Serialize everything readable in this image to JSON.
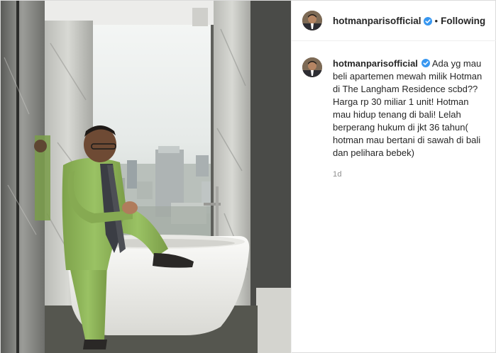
{
  "post": {
    "username": "hotmanparisofficial",
    "separator": "•",
    "follow_status": "Following",
    "caption_lines": [
      "Ada yg mau",
      "beli apartemen mewah milik Hotman",
      "di The Langham Residence scbd??",
      "Harga rp 30 miliar 1 unit! Hotman",
      "mau hidup tenang di bali! Lelah",
      "berperang hukum di jkt 36 tahun(",
      "hotman mau bertani di sawah di bali",
      "dan pelihara bebek)"
    ],
    "timestamp": "1d"
  },
  "colors": {
    "verified_badge": "#3897f0",
    "suit_green": "#8fb35a",
    "text_primary": "#262626",
    "text_secondary": "#8e8e8e"
  },
  "icons": {
    "verified": "verified-badge-icon"
  }
}
